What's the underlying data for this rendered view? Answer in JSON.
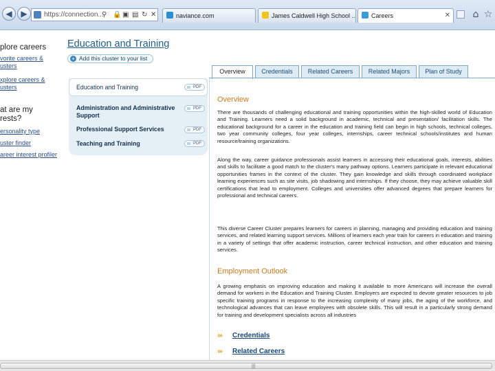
{
  "browser": {
    "address": "https://connection...",
    "tabs": [
      {
        "label": "naviance.com",
        "favicon_color": "#2a8fd0"
      },
      {
        "label": "James Caldwell High School ...",
        "favicon_color": "#f0c419"
      },
      {
        "label": "Careers",
        "favicon_color": "#3a9bd8"
      }
    ],
    "active_tab": 2
  },
  "sidebar": {
    "explore_header": "plore careers",
    "links_a": [
      {
        "line1": "vorite careers &",
        "line2": "usters"
      },
      {
        "line1": "xplore careers &",
        "line2": "usters"
      }
    ],
    "interests_header_1": "at are my",
    "interests_header_2": "rests?",
    "links_b": [
      "ersonality type",
      "uster finder",
      "areer interest profiler"
    ]
  },
  "cluster": {
    "title": "Education and Training",
    "add_button": "Add this cluster to your list"
  },
  "pathways": {
    "items": [
      {
        "label": "Education and Training",
        "pdf": "PDF"
      },
      {
        "label": "Administration and Administrative Support",
        "pdf": "PDF"
      },
      {
        "label": "Professional Support Services",
        "pdf": "PDF"
      },
      {
        "label": "Teaching and Training",
        "pdf": "PDF"
      }
    ]
  },
  "content_tabs": [
    "Overview",
    "Credentials",
    "Related Careers",
    "Related Majors",
    "Plan of Study"
  ],
  "active_content_tab": 0,
  "content": {
    "overview_heading": "Overview",
    "p1": "There are thousands of challenging educational and training opportunities within the high-skilled world of Education and Training. Learners need a solid background in academic, technical and presentation/ facilitation skills. The educational background for a career in the education and training field can begin in high schools, technical colleges, two year community colleges, four year colleges, internships, career technical schools/institutes and human resource/training organizations.",
    "p2": "Along the way, career guidance professionals assist learners in accessing their educational goals, interests, abilities and skills to facilitate a good match to the cluster's many pathway options. Learners participate in relevant educational opportunities frames in the context of the cluster. They gain knowledge and skills through coordinated workplace learning experiences such as site visits, job shadowing and internships. If they choose, they may achieve valuable skill certifications that lead to employment. Colleges and universities offer advanced degrees that prepare learners for professional and technical careers.",
    "p3": "This diverse Career Cluster prepares learners for careers in planning, managing and providing education and training services, and related learning support services. Millions of learners each year train for careers in education and training in a variety of settings that offer academic instruction, career technical instruction, and other education and training services.",
    "employment_heading": "Employment Outlook",
    "p4": "A growing emphasis on improving education and making it available to more Americans will increase the overall demand for workers in the Education and Training Cluster. Employers are expected to devote greater resources to job specific training programs in response to the increasing complexity of many jobs, the aging of the workforce, and technological advances that can leave employees with obsolete skills. This will result in a particularly strong demand for training and development specialists across all industries",
    "links": [
      "Credentials",
      "Related Careers"
    ]
  }
}
